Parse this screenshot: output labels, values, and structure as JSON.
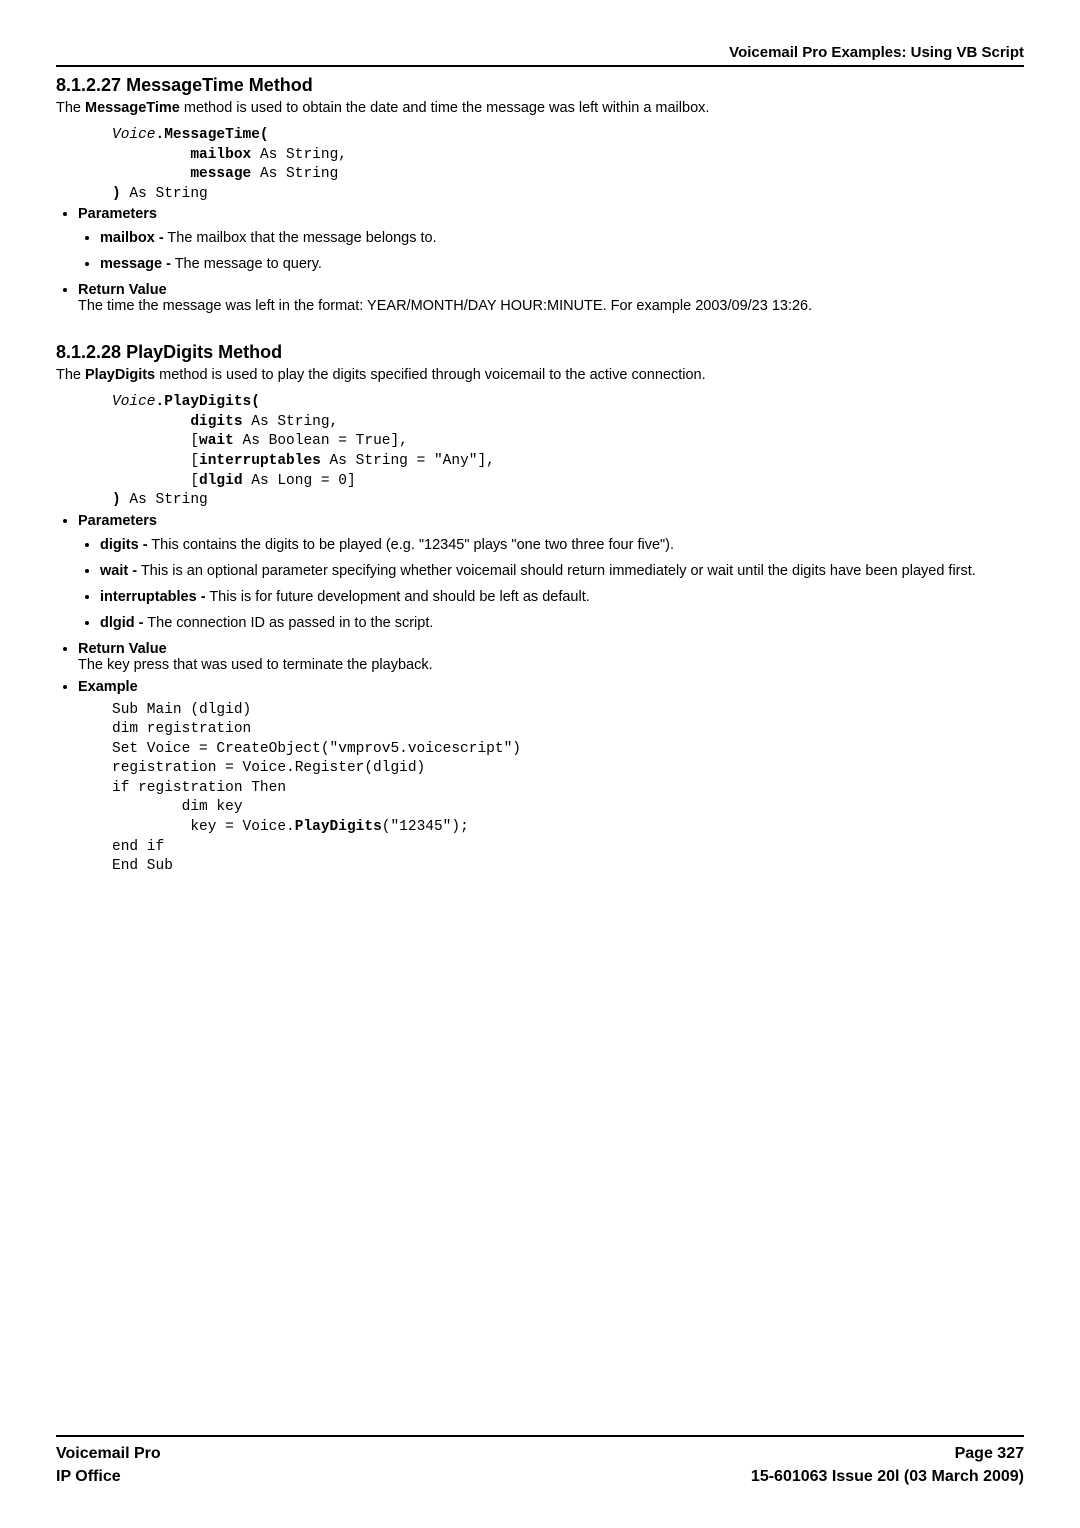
{
  "runningHead": "Voicemail Pro Examples: Using VB Script",
  "section1": {
    "number": "8.1.2.27",
    "title": "MessageTime Method",
    "lead_pre": "The ",
    "lead_bold": "MessageTime",
    "lead_post": " method is used to obtain the date and time the message was left within a mailbox.",
    "code_ln1_i": "Voice",
    "code_ln1_b": ".MessageTime(",
    "code_ln2_b": "mailbox",
    "code_ln2": " As String,",
    "code_ln3_b": "message",
    "code_ln3": " As String",
    "code_ln4_b": ")",
    "code_ln4": " As String",
    "params_label": "Parameters",
    "param1_b": "mailbox -",
    "param1": " The mailbox that the message belongs to.",
    "param2_b": "message -",
    "param2": " The message to query.",
    "return_label": "Return Value",
    "return_text": "The time the message was left in the format: YEAR/MONTH/DAY HOUR:MINUTE. For example 2003/09/23 13:26."
  },
  "section2": {
    "number": "8.1.2.28",
    "title": "PlayDigits Method",
    "lead_pre": "The ",
    "lead_bold": "PlayDigits",
    "lead_post": " method is used to play the digits specified through voicemail to the active connection.",
    "code_ln1_i": "Voice",
    "code_ln1_b": ".PlayDigits(",
    "code_ln2_b": "digits",
    "code_ln2": " As String,",
    "code_ln3_pre": "[",
    "code_ln3_b": "wait",
    "code_ln3": " As Boolean = True],",
    "code_ln4_pre": "[",
    "code_ln4_b": "interruptables",
    "code_ln4": " As String = \"Any\"],",
    "code_ln5_pre": "[",
    "code_ln5_b": "dlgid",
    "code_ln5": " As Long = 0]",
    "code_ln6_b": ")",
    "code_ln6": " As String",
    "params_label": "Parameters",
    "param1_b": "digits -",
    "param1": " This contains the digits to be played (e.g. \"12345\" plays \"one two three four five\").",
    "param2_b": "wait -",
    "param2": " This is an optional parameter specifying whether voicemail should return immediately or wait until the digits have been played first.",
    "param3_b": "interruptables -",
    "param3": " This is for future development and should be left as default.",
    "param4_b": "dlgid -",
    "param4": " The connection ID as passed in to the script.",
    "return_label": "Return Value",
    "return_text": "The key press that was used to terminate the playback.",
    "example_label": "Example",
    "ex_ln1": "Sub Main (dlgid)",
    "ex_ln2": "dim registration",
    "ex_ln3": "Set Voice = CreateObject(\"vmprov5.voicescript\")",
    "ex_ln4": "registration = Voice.Register(dlgid)",
    "ex_ln5": "if registration Then",
    "ex_ln6": "dim key",
    "ex_ln7_pre": " key = Voice.",
    "ex_ln7_b": "PlayDigits",
    "ex_ln7_post": "(\"12345\");",
    "ex_ln8": "end if",
    "ex_ln9": "End Sub"
  },
  "footer": {
    "left1": "Voicemail Pro",
    "left2": "IP Office",
    "right1": "Page 327",
    "right2": "15-601063 Issue 20l (03 March 2009)"
  }
}
